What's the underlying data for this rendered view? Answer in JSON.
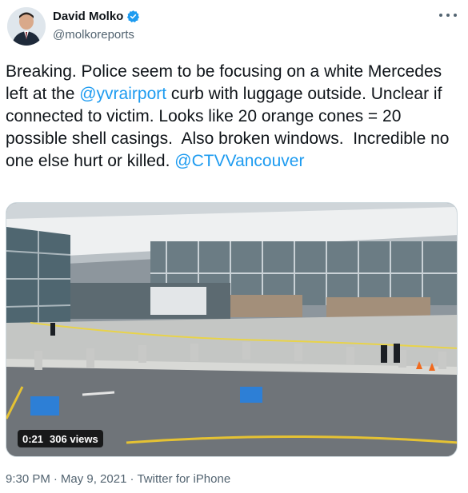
{
  "author": {
    "name": "David Molko",
    "handle": "@molkoreports",
    "verified_icon": "verified-badge-icon",
    "accent": "#1d9bf0"
  },
  "tweet": {
    "text_1": "Breaking. Police seem to be focusing on a white Mercedes left at the ",
    "mention_1": "@yvrairport",
    "text_2": " curb with luggage outside. Unclear if connected to victim. Looks like 20 orange cones = 20 possible shell casings.  Also broken windows.  Incredible no one else hurt or killed. ",
    "mention_2": "@CTVVancouver"
  },
  "media": {
    "duration": "0:21",
    "views": "306 views",
    "alt": "airport-curb-video"
  },
  "meta": {
    "time": "9:30 PM",
    "separator": "·",
    "date": "May 9, 2021",
    "source": "Twitter for iPhone"
  },
  "menu": {
    "icon": "more-options-icon"
  }
}
